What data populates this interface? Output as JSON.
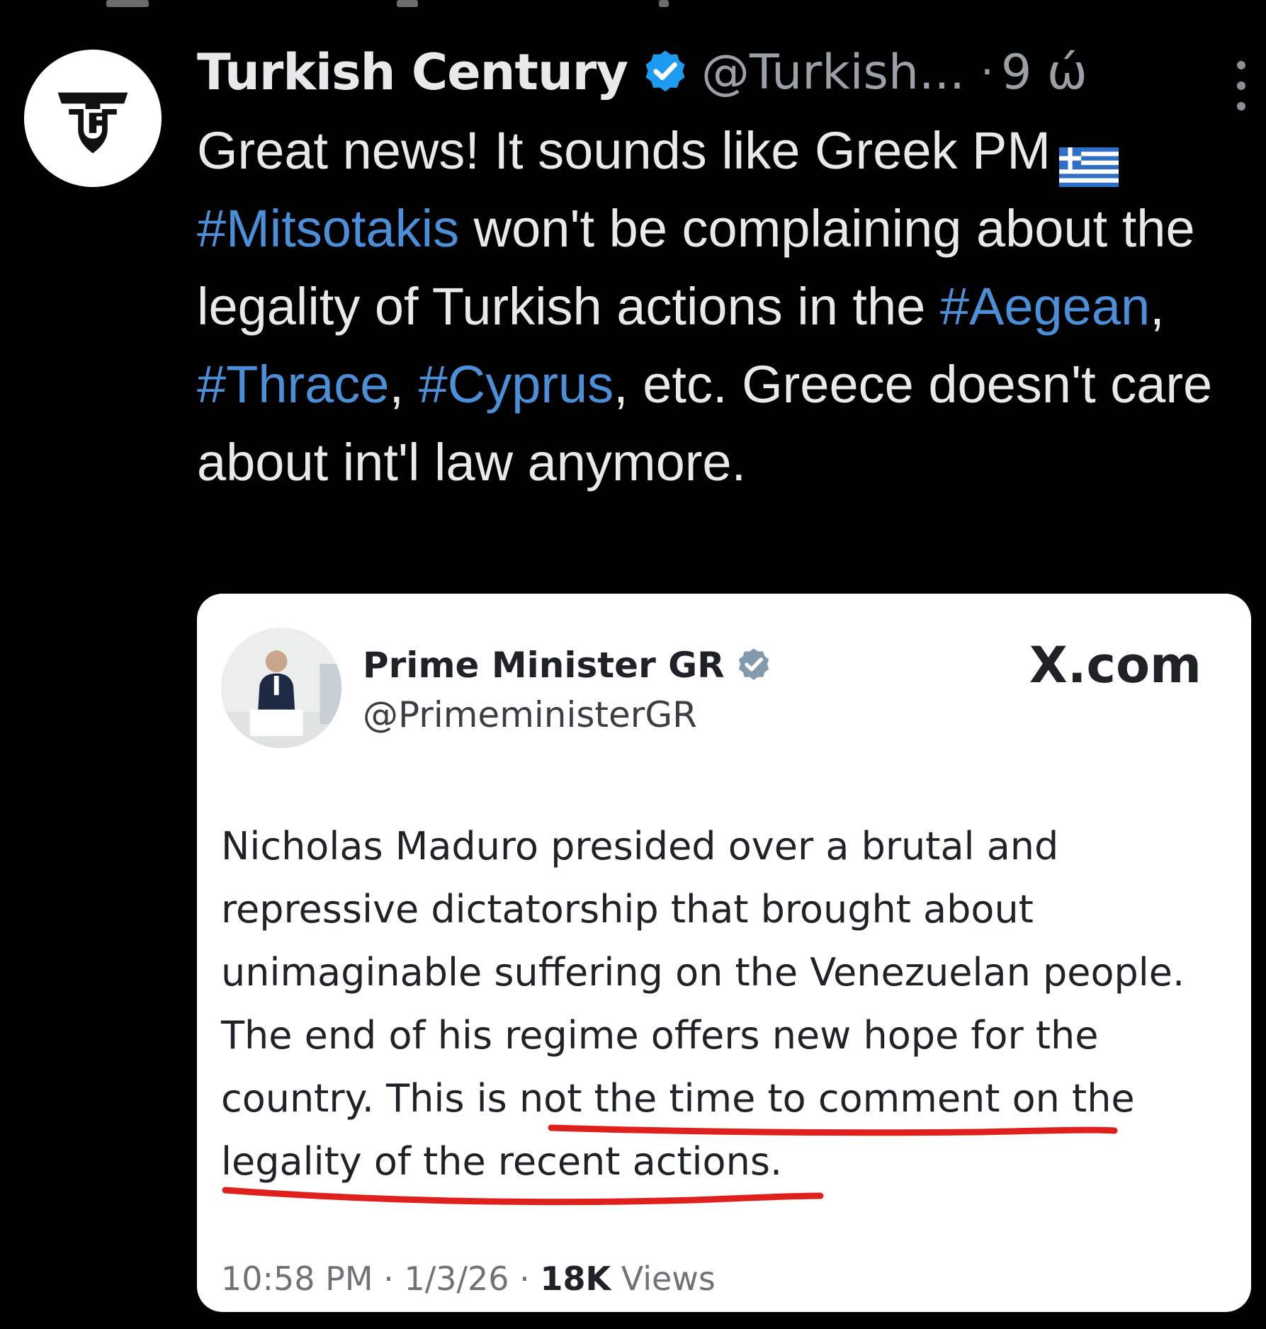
{
  "tweet": {
    "author_name": "Turkish Century",
    "author_handle": "@Turkish...",
    "separator": "·",
    "time": "9 ώ",
    "text_parts": {
      "p1": "Great news! It sounds like Greek PM",
      "h_mitsotakis": "#Mitsotakis",
      "p2": " won't be complaining about the legality of Turkish actions in the ",
      "h_aegean": "#Aegean",
      "c1": ", ",
      "h_thrace": "#Thrace",
      "c2": ", ",
      "h_cyprus": "#Cyprus",
      "p3": ", etc. Greece doesn't care about int'l law anymore."
    },
    "hashtag_color": "#4a8fd8"
  },
  "icons": {
    "avatar": "turkish-century-logo",
    "verified": "verified-badge-icon",
    "more": "more-vertical-icon",
    "flag": "greece-flag-icon",
    "quote_verified": "gray-verified-badge-icon"
  },
  "quote": {
    "author_name": "Prime Minister GR",
    "author_handle": "@PrimeministerGR",
    "site": "X.com",
    "body_plain": "Nicholas Maduro presided over a brutal and repressive dictatorship that brought about unimaginable suffering on the Venezuelan people. The end of his regime offers new hope for the country. ",
    "body_underlined": "This is not the time to comment on the legality of the recent actions.",
    "footer": {
      "time": "10:58 PM",
      "sep1": " · ",
      "date": "1/3/26",
      "sep2": " · ",
      "views_count": "18K",
      "views_label": " Views"
    },
    "underline_color": "#e0201c"
  }
}
